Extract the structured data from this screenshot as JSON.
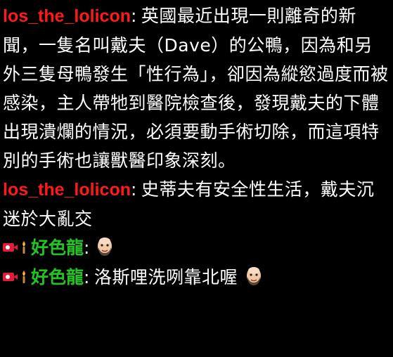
{
  "colors": {
    "background": "#000000",
    "message_text": "#ffffff",
    "user_red": "#ff1a1a",
    "user_green": "#22c322",
    "badge_red": "#e21d3a"
  },
  "messages": [
    {
      "username": "los_the_lolicon",
      "colon": ":",
      "text": "英國最近出現一則離奇的新聞，一隻名叫戴夫（Dave）的公鴨，因為和另外三隻母鴨發生「性行為」，卻因為縱慾過度而被感染，主人帶牠到醫院檢查後，發現戴夫的下體出現潰爛的情況，必須要動手術切除，而這項特別的手術也讓獸醫印象深刻。"
    },
    {
      "username": "los_the_lolicon",
      "colon": ":",
      "text": "史蒂夫有安全性生活，戴夫沉迷於大亂交"
    },
    {
      "badges": [
        "camera-badge",
        "torch-badge"
      ],
      "username": "好色龍",
      "colon": ":",
      "text": "",
      "emote": "bald-man-face-emote"
    },
    {
      "badges": [
        "camera-badge",
        "torch-badge"
      ],
      "username": "好色龍",
      "colon": ":",
      "text": "洛斯哩洗咧靠北喔",
      "emote": "bald-man-face-emote"
    }
  ]
}
